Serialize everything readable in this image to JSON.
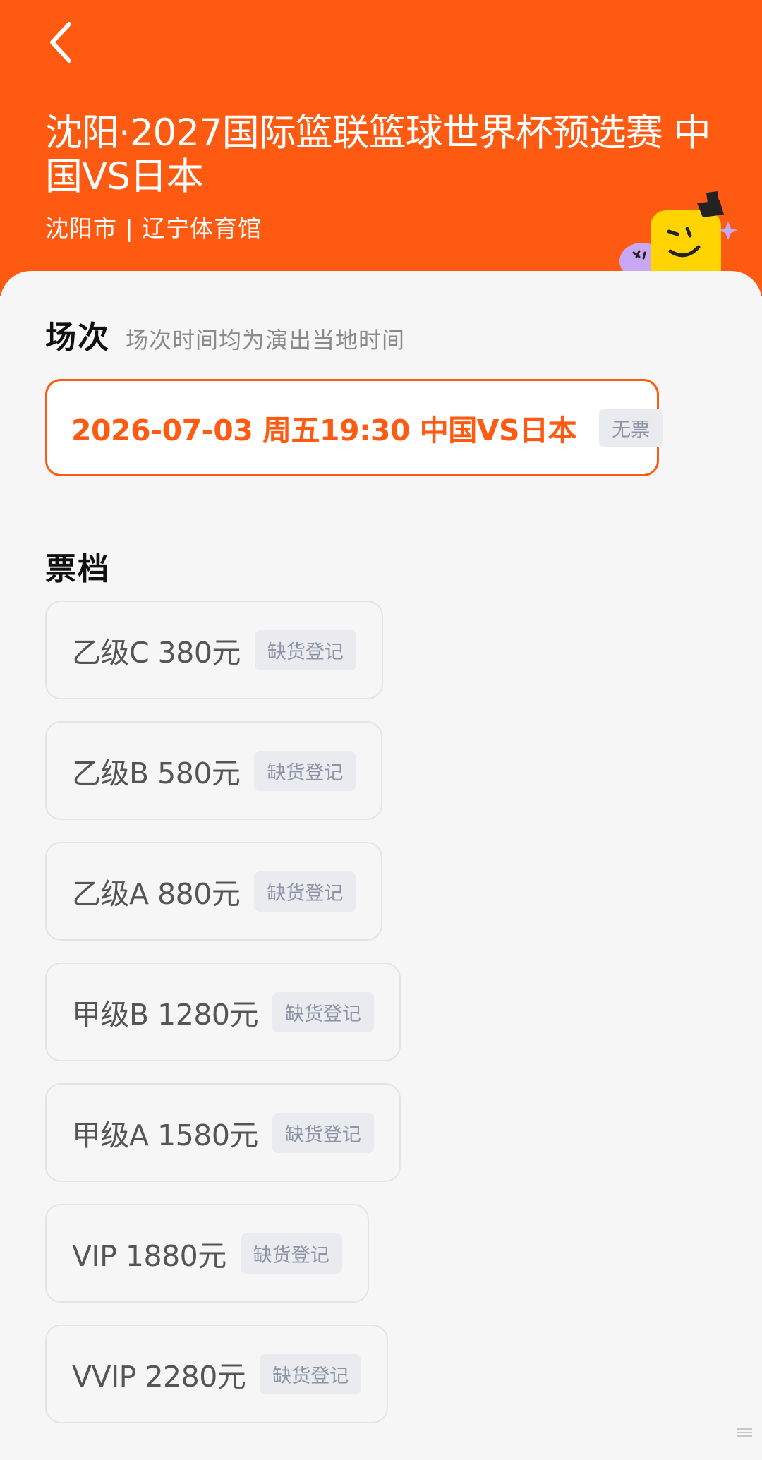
{
  "header": {
    "title": "沈阳·2027国际篮联篮球世界杯预选赛 中国VS日本",
    "venue": "沈阳市 | 辽宁体育馆",
    "back_icon": "chevron-left-icon",
    "bg_color": "#ff5a12"
  },
  "session_section": {
    "title": "场次",
    "note": "场次时间均为演出当地时间",
    "selected_session": {
      "label": "2026-07-03  周五19:30 中国VS日本",
      "status": "无票"
    }
  },
  "tier_section": {
    "title": "票档",
    "tiers": [
      {
        "label": "乙级C 380元",
        "status": "缺货登记"
      },
      {
        "label": "乙级B 580元",
        "status": "缺货登记"
      },
      {
        "label": "乙级A 880元",
        "status": "缺货登记"
      },
      {
        "label": "甲级B 1280元",
        "status": "缺货登记"
      },
      {
        "label": "甲级A 1580元",
        "status": "缺货登记"
      },
      {
        "label": "VIP 1880元",
        "status": "缺货登记"
      },
      {
        "label": "VVIP 2280元",
        "status": "缺货登记"
      }
    ]
  },
  "colors": {
    "accent": "#ff5a12",
    "tag_bg": "#e9ebef",
    "tag_text": "#8b93a5",
    "mascot_yellow": "#ffd400",
    "mascot_purple": "#c8a8f5"
  }
}
